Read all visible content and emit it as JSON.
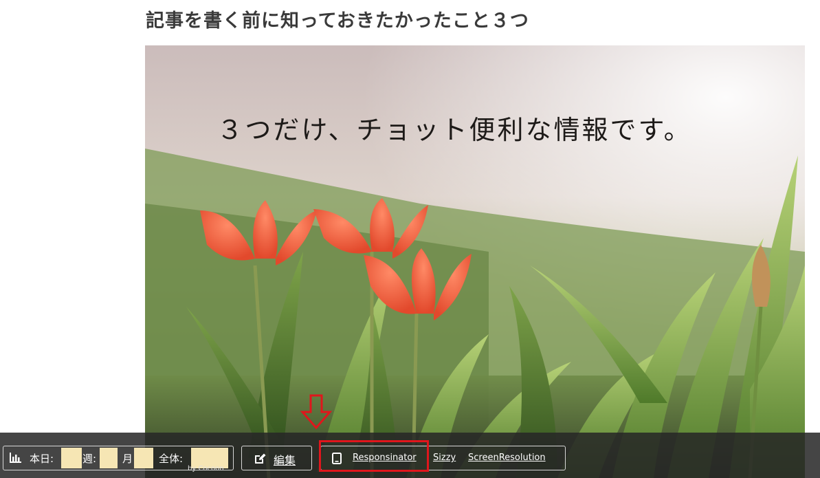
{
  "article": {
    "title": "記事を書く前に知っておきたかったこと３つ",
    "eyecatch_caption": "３つだけ、チョット便利な情報です。"
  },
  "icons": {
    "chart": "bar-chart-icon",
    "edit": "pencil-square-icon",
    "tablet": "tablet-icon",
    "annotation": "down-arrow-outline-icon"
  },
  "colors": {
    "admin_bar": "#262626",
    "highlight": "#e0161c",
    "redacted": "#f6e6b4"
  },
  "admin_bar": {
    "pv": {
      "today_label": "本日:",
      "week_label": "週:",
      "month_label": "月",
      "total_label": "全体:",
      "credit": "by Cocoon"
    },
    "edit_label": "編集",
    "tools": [
      "Responsinator",
      "Sizzy",
      "ScreenResolution"
    ]
  }
}
